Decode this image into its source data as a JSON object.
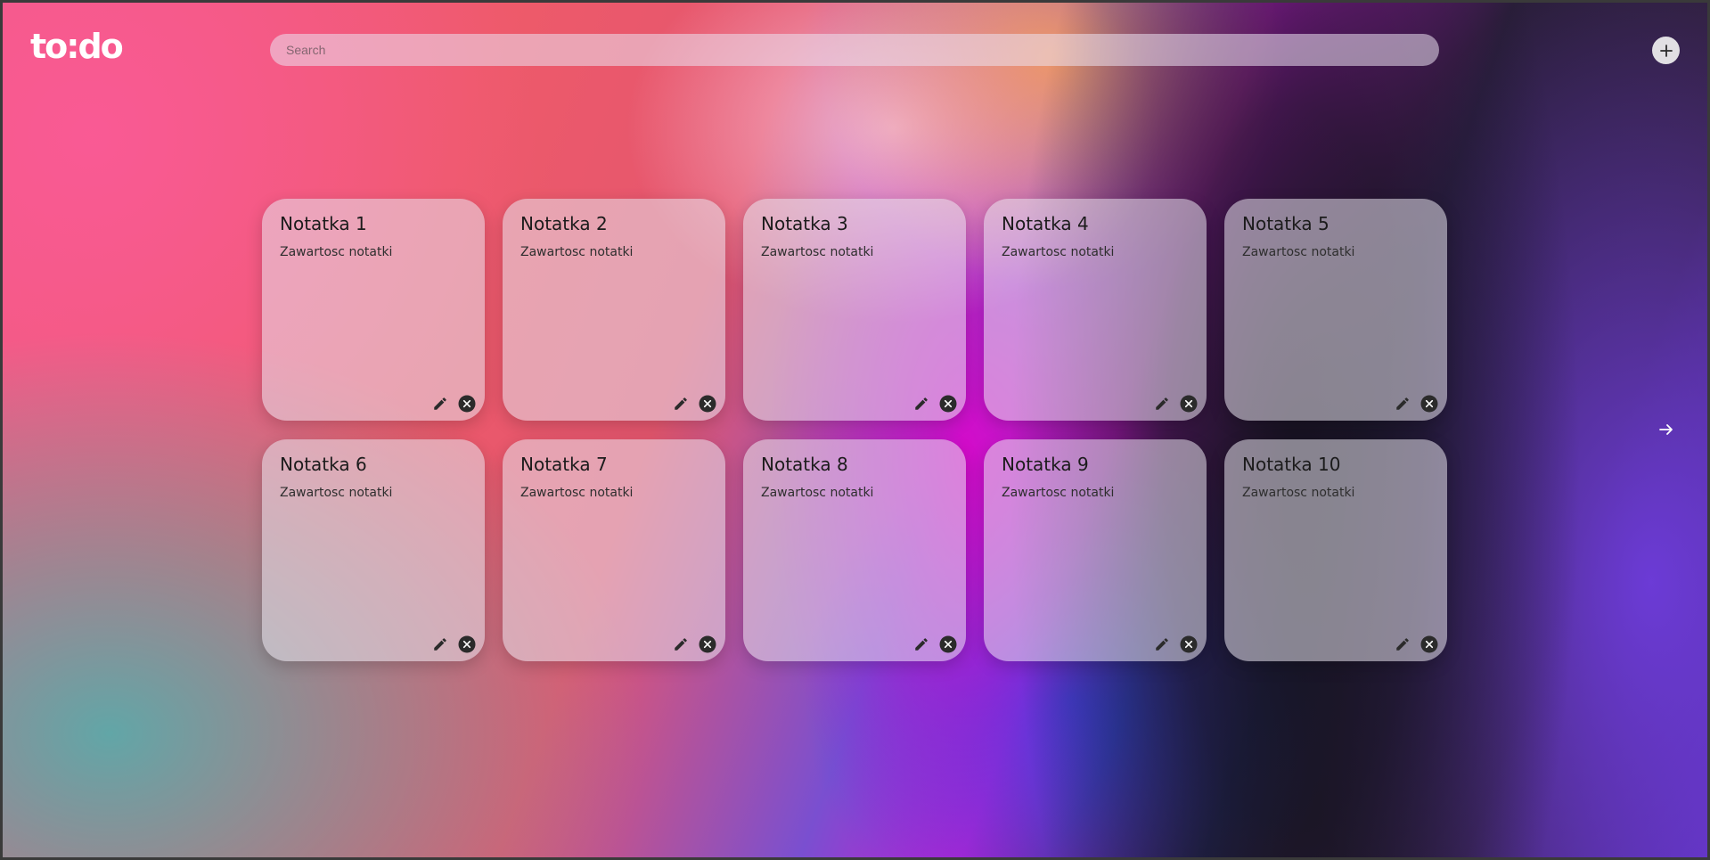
{
  "app": {
    "logo": "to:do"
  },
  "search": {
    "placeholder": "Search"
  },
  "actions": {
    "add_icon": "plus-icon",
    "next_icon": "arrow-right-icon"
  },
  "notes": [
    {
      "title": "Notatka 1",
      "content": "Zawartosc notatki"
    },
    {
      "title": "Notatka 2",
      "content": "Zawartosc notatki"
    },
    {
      "title": "Notatka 3",
      "content": "Zawartosc notatki"
    },
    {
      "title": "Notatka 4",
      "content": "Zawartosc notatki"
    },
    {
      "title": "Notatka 5",
      "content": "Zawartosc notatki"
    },
    {
      "title": "Notatka 6",
      "content": "Zawartosc notatki"
    },
    {
      "title": "Notatka 7",
      "content": "Zawartosc notatki"
    },
    {
      "title": "Notatka 8",
      "content": "Zawartosc notatki"
    },
    {
      "title": "Notatka 9",
      "content": "Zawartosc notatki"
    },
    {
      "title": "Notatka 10",
      "content": "Zawartosc notatki"
    }
  ],
  "colors": {
    "card_bg": "#e6e1eb",
    "icon_dark": "#2b2b2b",
    "logo": "#ffffff"
  }
}
